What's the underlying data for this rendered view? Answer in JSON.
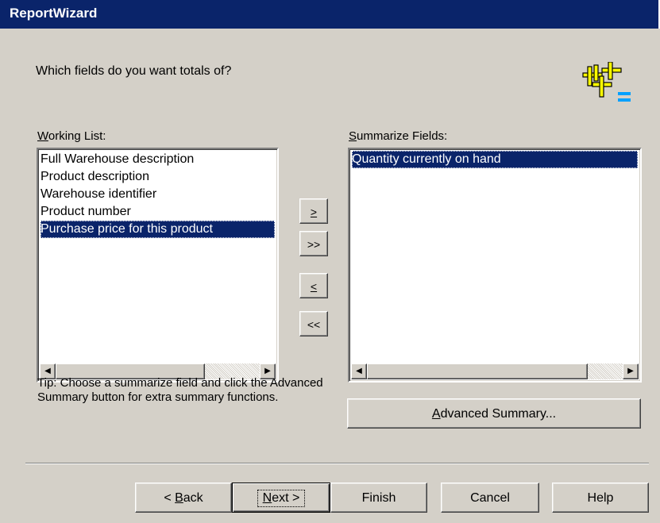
{
  "window": {
    "title": "ReportWizard"
  },
  "header": {
    "question": "Which fields do you want totals of?",
    "logo_icon": "sigma-plus-equals-icon"
  },
  "working_list": {
    "label_accel": "W",
    "label_rest": "orking List:",
    "items": [
      "Full Warehouse description",
      "Product description",
      "Warehouse identifier",
      "Product number",
      "Purchase price for this product"
    ],
    "selected_index": 4
  },
  "summarize_fields": {
    "label_accel": "S",
    "label_rest": "ummarize Fields:",
    "items": [
      "Quantity currently on hand"
    ],
    "selected_index": 0
  },
  "move_buttons": {
    "add_one": ">",
    "add_all": ">>",
    "remove_one": "<",
    "remove_all": "<<"
  },
  "scrollbar_icons": {
    "left": "triangle-left-icon",
    "right": "triangle-right-icon"
  },
  "tip": "Tip:  Choose a summarize field and click the Advanced Summary button for extra summary functions.",
  "advanced_summary": {
    "accel": "A",
    "rest": "dvanced Summary..."
  },
  "nav": {
    "back_prefix": "< ",
    "back_accel": "B",
    "back_rest": "ack",
    "next_accel": "N",
    "next_rest": "ext >",
    "finish": "Finish",
    "cancel": "Cancel",
    "help": "Help"
  },
  "colors": {
    "selection": "#0a246a",
    "face": "#d4d0c8",
    "titlebar": "#0a246a"
  }
}
